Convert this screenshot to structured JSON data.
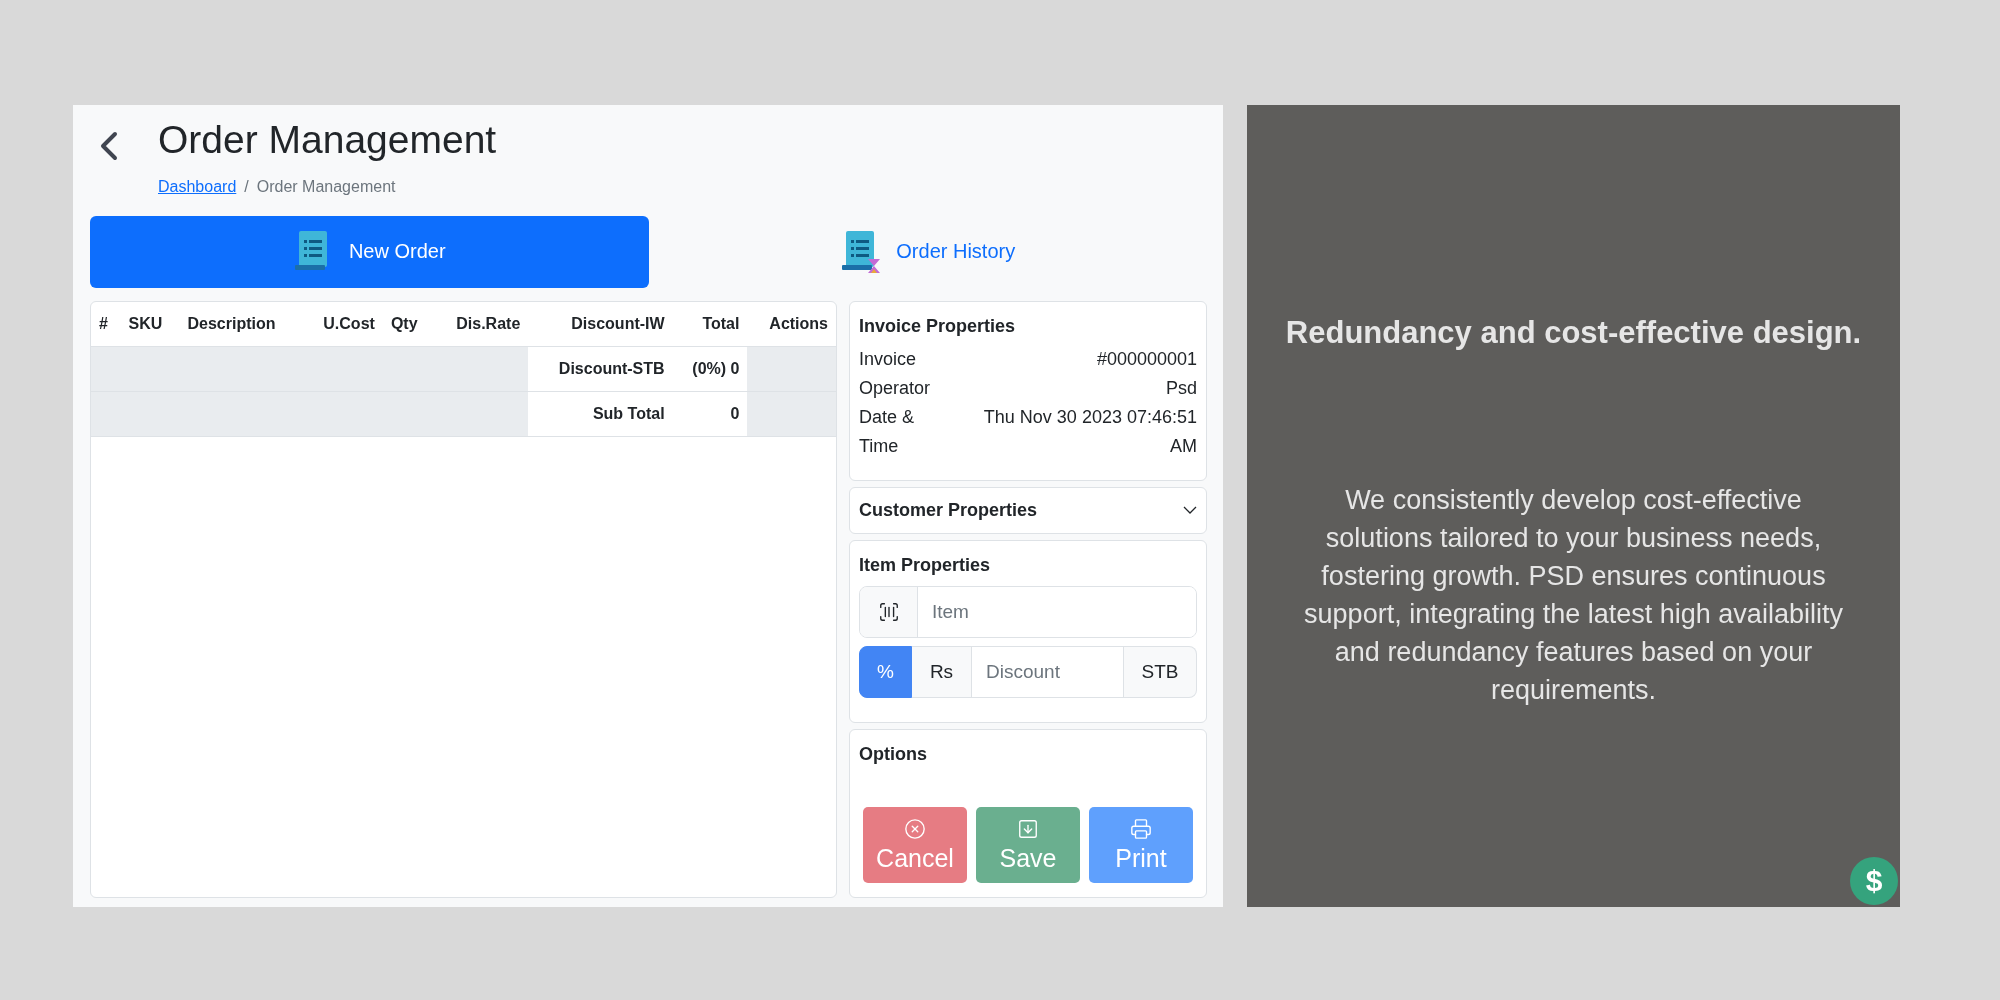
{
  "header": {
    "title": "Order Management",
    "breadcrumb": [
      {
        "label": "Dashboard",
        "link": true
      },
      {
        "label": "Order Management",
        "link": false
      }
    ],
    "separator": "/"
  },
  "tabs": [
    {
      "label": "New Order",
      "kind": "list",
      "selected": true
    },
    {
      "label": "Order History",
      "kind": "history",
      "selected": false
    }
  ],
  "table": {
    "columns": [
      "#",
      "SKU",
      "Description",
      "U.Cost",
      "Qty",
      "Dis.Rate",
      "Discount-IW",
      "Total",
      "Actions"
    ],
    "summary_rows": [
      {
        "label": "Discount-STB",
        "value": "(0%) 0"
      },
      {
        "label": "Sub Total",
        "value": "0"
      }
    ]
  },
  "invoice": {
    "title": "Invoice Properties",
    "rows": [
      {
        "label": "Invoice",
        "value": "#000000001"
      },
      {
        "label": "Operator",
        "value": "Psd"
      },
      {
        "label": "Date & Time",
        "value": "Thu Nov 30 2023 07:46:51 AM"
      }
    ]
  },
  "customer": {
    "title": "Customer Properties",
    "expanded": false
  },
  "item": {
    "title": "Item Properties",
    "item_field": {
      "placeholder": "Item"
    },
    "discount": {
      "modes": [
        {
          "label": "%",
          "selected": true
        },
        {
          "label": "Rs",
          "selected": false
        }
      ],
      "placeholder": "Discount",
      "suffix": "STB"
    }
  },
  "options": {
    "title": "Options",
    "buttons": [
      {
        "label": "Cancel",
        "kind": "cancel"
      },
      {
        "label": "Save",
        "kind": "save"
      },
      {
        "label": "Print",
        "kind": "print"
      }
    ]
  },
  "promo": {
    "heading": "Redundancy and cost-effective design.",
    "body": "We consistently develop cost-effective solutions tailored to your business needs, fostering growth. PSD ensures continuous support, integrating the latest high availability and redundancy features based on your requirements.",
    "badge": "$"
  }
}
